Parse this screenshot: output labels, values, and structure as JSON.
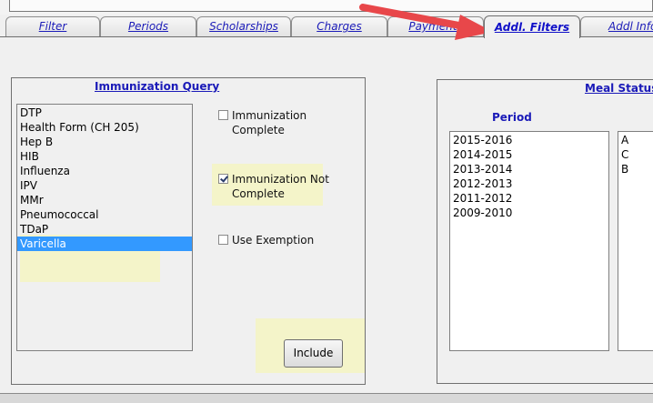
{
  "tabs": [
    {
      "label": "Filter"
    },
    {
      "label": "Periods"
    },
    {
      "label": "Scholarships"
    },
    {
      "label": "Charges"
    },
    {
      "label": "Payments"
    },
    {
      "label": "Addl. Filters"
    },
    {
      "label": "Addl Info"
    }
  ],
  "active_tab": "Addl. Filters",
  "immunization": {
    "title": "Immunization Query",
    "items": [
      "DTP",
      "Health Form (CH 205)",
      "Hep B",
      "HIB",
      "Influenza",
      "IPV",
      "MMr",
      "Pneumococcal",
      "TDaP",
      "Varicella"
    ],
    "selected": "Varicella",
    "checkboxes": [
      {
        "label_line1": "Immunization",
        "label_line2": "Complete",
        "checked": false
      },
      {
        "label_line1": "Immunization Not",
        "label_line2": "Complete",
        "checked": true
      },
      {
        "label_line1": "Use Exemption",
        "label_line2": "",
        "checked": false
      }
    ],
    "include_button": "Include"
  },
  "meal_status": {
    "title": "Meal Status",
    "period_label": "Period",
    "periods": [
      "2015-2016",
      "2014-2015",
      "2013-2014",
      "2012-2013",
      "2011-2012",
      "2009-2010"
    ],
    "codes": [
      "A",
      "C",
      "B"
    ]
  },
  "colors": {
    "arrow": "#e8474a",
    "highlight": "#f6f6bc",
    "selection": "#3399ff",
    "link": "#1a1ab8"
  }
}
